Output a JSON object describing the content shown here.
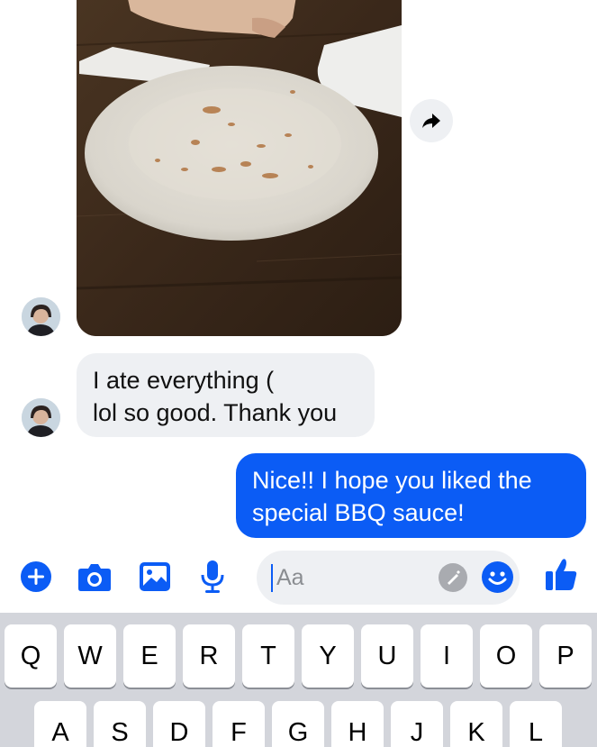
{
  "conversation": {
    "incoming_message": {
      "lines": [
        "I ate everything (",
        "lol so good. Thank you"
      ]
    },
    "outgoing_message": {
      "lines": [
        "Nice!!  I hope you liked the",
        "special BBQ sauce!"
      ]
    }
  },
  "composer": {
    "placeholder": "Aa",
    "icons": [
      "plus-icon",
      "camera-icon",
      "gallery-icon",
      "microphone-icon",
      "sticker-icon",
      "emoji-icon",
      "thumbs-up-icon"
    ]
  },
  "keyboard": {
    "row1": [
      "Q",
      "W",
      "E",
      "R",
      "T",
      "Y",
      "U",
      "I",
      "O",
      "P"
    ],
    "row2": [
      "A",
      "S",
      "D",
      "F",
      "G",
      "H",
      "J",
      "K",
      "L"
    ]
  },
  "colors": {
    "accent": "#0b5cf5",
    "incoming_bubble": "#eef0f3",
    "keyboard_bg": "#d3d5db"
  }
}
